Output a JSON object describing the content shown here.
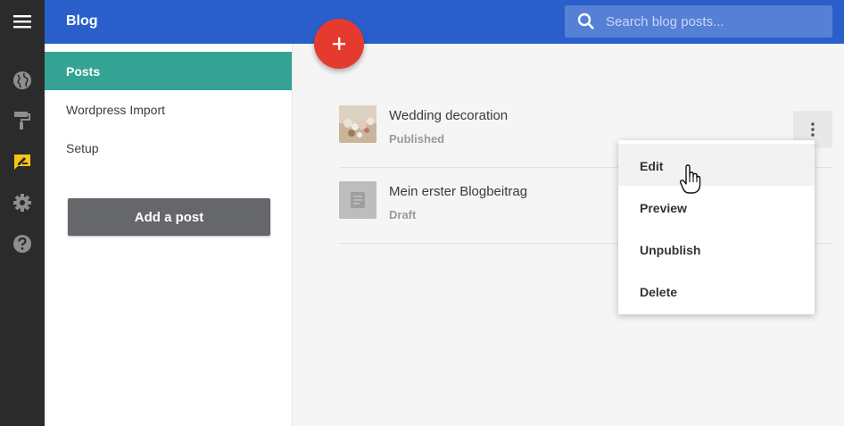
{
  "rail": {
    "items": [
      {
        "icon": "menu-icon"
      },
      {
        "icon": "globe-icon"
      },
      {
        "icon": "paint-roller-icon"
      },
      {
        "icon": "edit-blog-icon",
        "active": true,
        "color": "#f5c518"
      },
      {
        "icon": "gear-icon"
      },
      {
        "icon": "help-icon"
      }
    ]
  },
  "header": {
    "title": "Blog",
    "search_placeholder": "Search blog posts..."
  },
  "sidebar": {
    "items": [
      {
        "label": "Posts",
        "active": true
      },
      {
        "label": "Wordpress Import"
      },
      {
        "label": "Setup"
      }
    ],
    "add_button": "Add a post"
  },
  "posts": [
    {
      "title": "Wedding decoration",
      "status": "Published",
      "thumbnail": "photo"
    },
    {
      "title": "Mein erster Blogbeitrag",
      "status": "Draft",
      "thumbnail": "document-icon"
    }
  ],
  "context_menu": {
    "items": [
      "Edit",
      "Preview",
      "Unpublish",
      "Delete"
    ],
    "hovered": "Edit"
  },
  "colors": {
    "header": "#2a5fcb",
    "sidebar_active": "#35a394",
    "fab": "#e53b2f",
    "rail": "#2b2b2b"
  }
}
